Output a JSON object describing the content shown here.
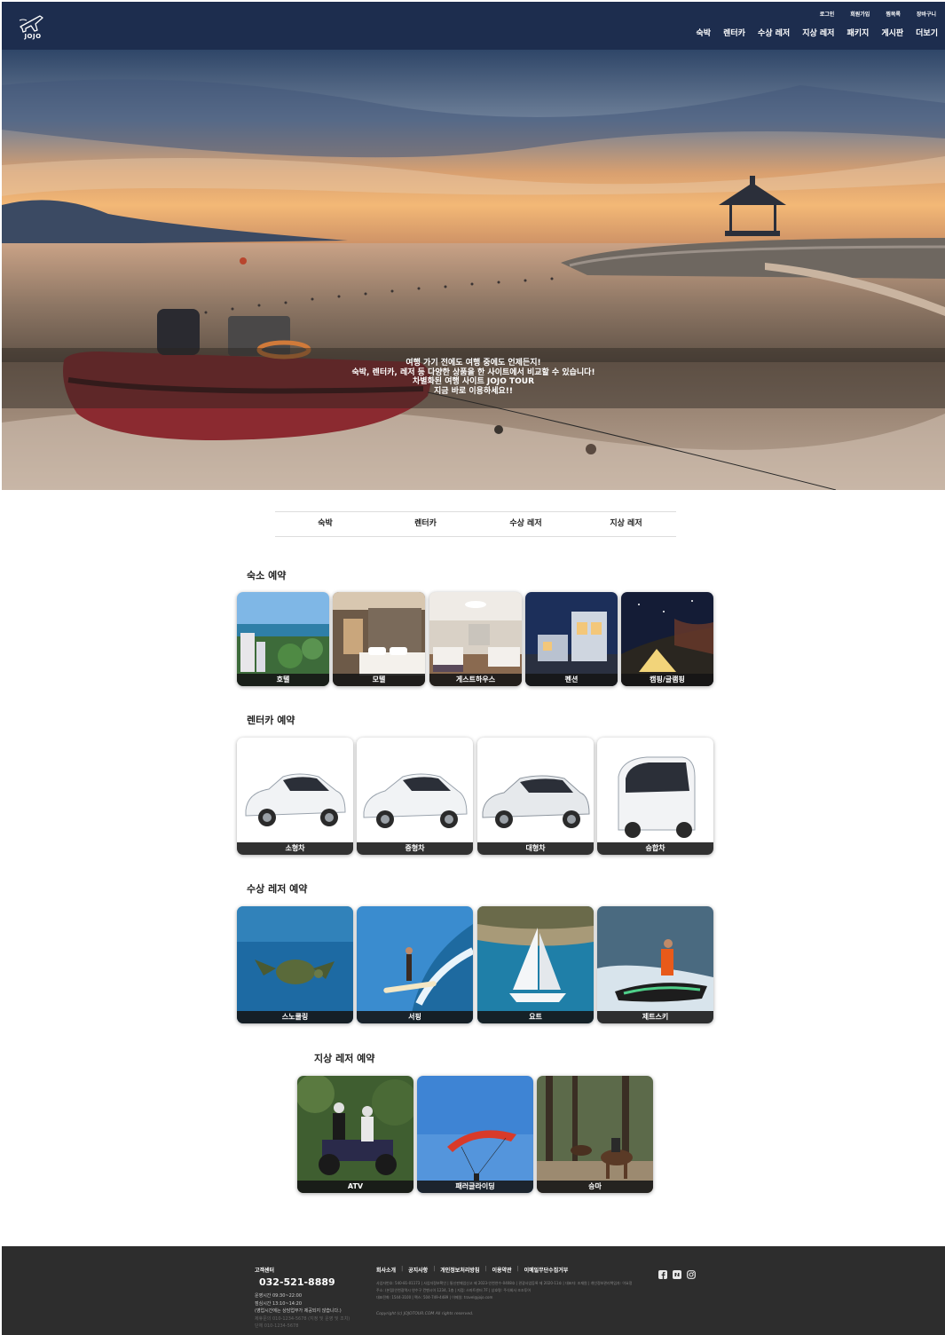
{
  "header": {
    "logo_text": "JOJO",
    "util_nav": [
      "로그인",
      "회원가입",
      "찜목록",
      "장바구니"
    ],
    "main_nav": [
      "숙박",
      "렌터카",
      "수상 레저",
      "지상 레저",
      "패키지",
      "게시판",
      "더보기"
    ],
    "bg_color": "#1d2d4e"
  },
  "hero": {
    "caption_lines": [
      "여행 가기 전에도 여행 중에도 언제든지!",
      "숙박, 렌터카, 레저 등 다양한 상품을 한 사이트에서 비교할 수 있습니다!",
      "차별화된 여행 사이트 JOJO TOUR",
      "지금 바로 이용하세요!!"
    ]
  },
  "tabs": [
    "숙박",
    "렌터카",
    "수상 레저",
    "지상 레저"
  ],
  "sections": {
    "stay": {
      "title": "숙소 예약",
      "items": [
        "호텔",
        "모텔",
        "게스트하우스",
        "펜션",
        "캠핑/글램핑"
      ]
    },
    "car": {
      "title": "렌터카 예약",
      "items": [
        "소형차",
        "중형차",
        "대형차",
        "승합차"
      ]
    },
    "water": {
      "title": "수상 레저 예약",
      "items": [
        "스노쿨링",
        "서핑",
        "요트",
        "제트스키"
      ]
    },
    "land": {
      "title": "지상 레저 예약",
      "items": [
        "ATV",
        "패러글라이딩",
        "승마"
      ]
    }
  },
  "footer": {
    "cs_title": "고객센터",
    "phone": "032-521-8889",
    "hours": [
      "운영시간   09:30~22:00",
      "점심시간   13:10~14:20",
      "(영업시간에는 상담업무가 제공되지 않습니다.)"
    ],
    "hours_faint": [
      "제휴문의   010-1234-5678 (지정 및 운영 및 조치)",
      "단체   010-1234-5678"
    ],
    "links": [
      "회사소개",
      "공지사항",
      "개인정보처리방침",
      "이용약관",
      "이메일무단수집거부"
    ],
    "info_lines": [
      "사업자번호: 540-81-01173 | 사업자정보확인 | 통신판매업신고 제 2023-인천연수-0408호 | 관광사업등록 제 2020-11호 | 대표자: 조재원 | 개인정보관리책임자: 이요정",
      "주소: (본점)인천광역시 연수구 컨벤시아 1234, 1층 | 지점: 스마트센터 7F | 상호명: 주식회사 조조투어",
      "대표전화: 1544-3100 | 팩스: 504-749-4489 | 이메일: travel@jojo.com"
    ],
    "copyright": "Copyright (c) JOJOTOUR.COM   All rights reserved.",
    "sns": [
      "facebook-icon",
      "blog-icon",
      "instagram-icon"
    ]
  }
}
